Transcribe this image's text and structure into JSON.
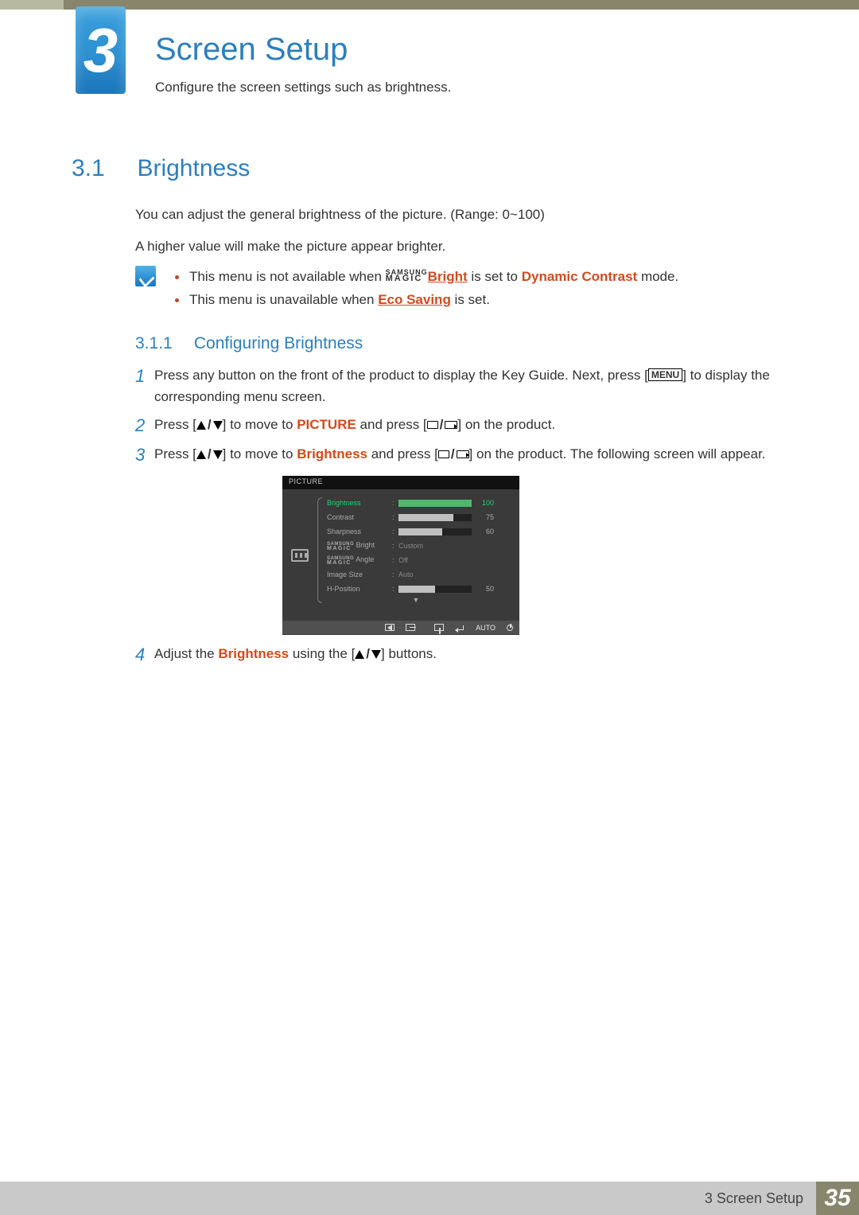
{
  "chapter": {
    "number": "3",
    "title": "Screen Setup",
    "description": "Configure the screen settings such as brightness."
  },
  "section": {
    "number": "3.1",
    "title": "Brightness",
    "para1": "You can adjust the general brightness of the picture. (Range: 0~100)",
    "para2": "A higher value will make the picture appear brighter."
  },
  "notes": {
    "item1_pre": "This menu is not available when ",
    "item1_brand_top": "SAMSUNG",
    "item1_brand_bot": "MAGIC",
    "item1_bright": "Bright",
    "item1_mid": " is set to ",
    "item1_hl": "Dynamic Contrast",
    "item1_post": " mode.",
    "item2_pre": "This menu is unavailable when ",
    "item2_hl": "Eco Saving",
    "item2_post": " is set."
  },
  "subsection": {
    "number": "3.1.1",
    "title": "Configuring Brightness"
  },
  "steps": {
    "s1": {
      "n": "1",
      "a": "Press any button on the front of the product to display the Key Guide. Next, press [",
      "menu": "MENU",
      "b": "] to display the corresponding menu screen."
    },
    "s2": {
      "n": "2",
      "a": "Press [",
      "b": "] to move to ",
      "hl": "PICTURE",
      "c": " and press [",
      "d": "] on the product."
    },
    "s3": {
      "n": "3",
      "a": "Press [",
      "b": "] to move to ",
      "hl": "Brightness",
      "c": " and press [",
      "d": "] on the product. The following screen will appear."
    },
    "s4": {
      "n": "4",
      "a": "Adjust the ",
      "hl": "Brightness",
      "b": " using the [",
      "c": "] buttons."
    }
  },
  "osd": {
    "header": "PICTURE",
    "rows": [
      {
        "label": "Brightness",
        "value": "100",
        "barPct": 100,
        "active": true,
        "bar": true
      },
      {
        "label": "Contrast",
        "value": "75",
        "barPct": 75,
        "barGrey": true,
        "bar": true
      },
      {
        "label": "Sharpness",
        "value": "60",
        "barPct": 60,
        "barGrey": true,
        "bar": true
      },
      {
        "label": "MAGIC Bright",
        "text": "Custom",
        "magic": true
      },
      {
        "label": "MAGIC Angle",
        "text": "Off",
        "magic": true
      },
      {
        "label": "Image Size",
        "text": "Auto"
      },
      {
        "label": "H-Position",
        "value": "50",
        "barPct": 50,
        "barGrey": true,
        "bar": true
      }
    ],
    "magic_top": "SAMSUNG",
    "magic_bot": "MAGIC",
    "auto": "AUTO",
    "more": "▼"
  },
  "footer": {
    "label": "3 Screen Setup",
    "page": "35"
  }
}
